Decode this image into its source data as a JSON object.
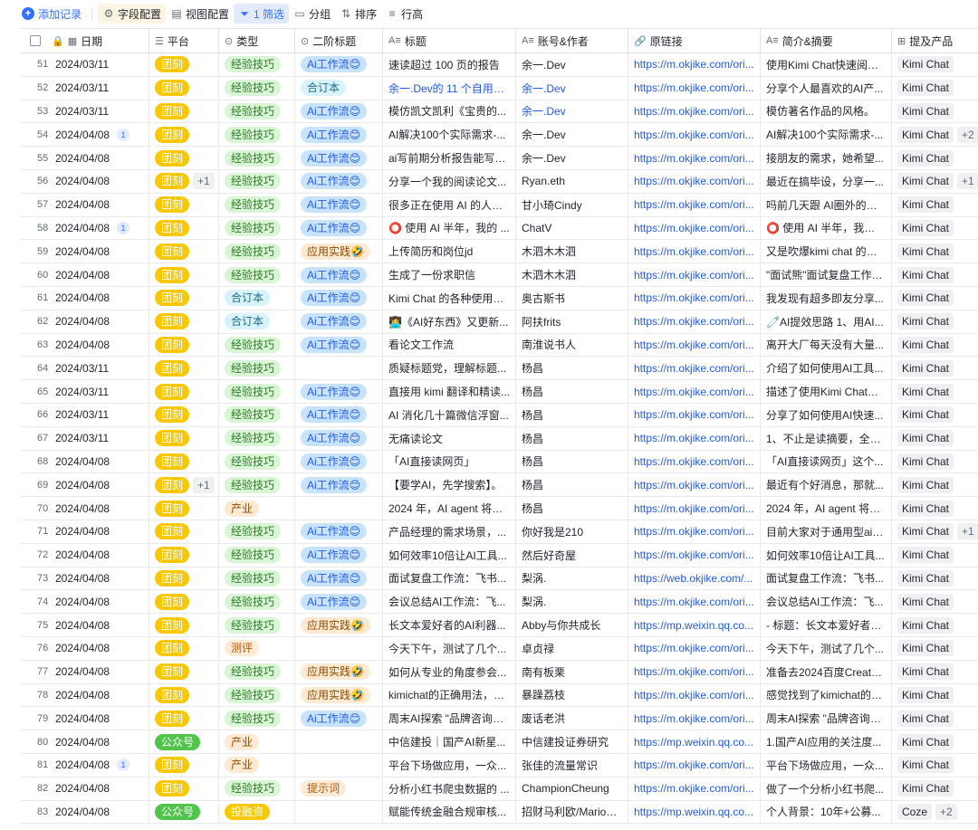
{
  "toolbar": {
    "add": "添加记录",
    "fields": "字段配置",
    "views": "视图配置",
    "filter": "1 筛选",
    "group": "分组",
    "sort": "排序",
    "rowheight": "行高"
  },
  "columns": {
    "date": "日期",
    "platform": "平台",
    "type": "类型",
    "sub": "二阶标题",
    "title": "标题",
    "author": "账号&作者",
    "link": "原链接",
    "summary": "简介&摘要",
    "product": "提及产品"
  },
  "colors": {
    "accent": "#3370ff",
    "tuoke_tag": "#fac800",
    "wechat_tag": "#51c44c"
  },
  "rows": [
    {
      "n": "51",
      "date": "2024/03/11",
      "badge": "",
      "plat": "团刻",
      "platc": "t-yellow",
      "platmore": "",
      "type": "经验技巧",
      "typec": "t-lgreen",
      "sub": "Ai工作流😊",
      "subc": "t-blue",
      "title": "速读超过 100 页的报告",
      "author": "余一.Dev",
      "authorBlue": false,
      "link": "https://m.okjike.com/ori...",
      "sum": "使用Kimi Chat快速阅读...",
      "prod": "Kimi Chat",
      "prodmore": ""
    },
    {
      "n": "52",
      "date": "2024/03/11",
      "badge": "",
      "plat": "团刻",
      "platc": "t-yellow",
      "platmore": "",
      "type": "经验技巧",
      "typec": "t-lgreen",
      "sub": "合订本",
      "subc": "t-lblue",
      "title": "余一.Dev的 11 个自用最...",
      "titleBlue": true,
      "author": "余一.Dev",
      "authorBlue": true,
      "link": "https://m.okjike.com/ori...",
      "sum": "分享个人最喜欢的AI产...",
      "prod": "Kimi Chat",
      "prodmore": ""
    },
    {
      "n": "53",
      "date": "2024/03/11",
      "badge": "",
      "plat": "团刻",
      "platc": "t-yellow",
      "platmore": "",
      "type": "经验技巧",
      "typec": "t-lgreen",
      "sub": "Ai工作流😊",
      "subc": "t-blue",
      "title": "模仿凯文凯利《宝贵的...",
      "author": "余一.Dev",
      "authorBlue": true,
      "link": "https://m.okjike.com/ori...",
      "sum": "模仿著名作品的风格。",
      "prod": "Kimi Chat",
      "prodmore": ""
    },
    {
      "n": "54",
      "date": "2024/04/08",
      "badge": "1",
      "plat": "团刻",
      "platc": "t-yellow",
      "platmore": "",
      "type": "经验技巧",
      "typec": "t-lgreen",
      "sub": "Ai工作流😊",
      "subc": "t-blue",
      "title": "AI解决100个实际需求-...",
      "author": "余一.Dev",
      "authorBlue": false,
      "link": "https://m.okjike.com/ori...",
      "sum": "AI解决100个实际需求-...",
      "prod": "Kimi Chat",
      "prodmore": "+2"
    },
    {
      "n": "55",
      "date": "2024/04/08",
      "badge": "",
      "plat": "团刻",
      "platc": "t-yellow",
      "platmore": "",
      "type": "经验技巧",
      "typec": "t-lgreen",
      "sub": "Ai工作流😊",
      "subc": "t-blue",
      "title": "ai写前期分析报告能写成...",
      "author": "余一.Dev",
      "authorBlue": false,
      "link": "https://m.okjike.com/ori...",
      "sum": "接朋友的需求，她希望...",
      "prod": "Kimi Chat",
      "prodmore": ""
    },
    {
      "n": "56",
      "date": "2024/04/08",
      "badge": "",
      "plat": "团刻",
      "platc": "t-yellow",
      "platmore": "+1",
      "type": "经验技巧",
      "typec": "t-lgreen",
      "sub": "Ai工作流😊",
      "subc": "t-blue",
      "title": "分享一个我的阅读论文...",
      "author": "Ryan.eth",
      "authorBlue": false,
      "link": "https://m.okjike.com/ori...",
      "sum": "最近在搞毕设，分享一...",
      "prod": "Kimi Chat",
      "prodmore": "+1"
    },
    {
      "n": "57",
      "date": "2024/04/08",
      "badge": "",
      "plat": "团刻",
      "platc": "t-yellow",
      "platmore": "",
      "type": "经验技巧",
      "typec": "t-lgreen",
      "sub": "Ai工作流😊",
      "subc": "t-blue",
      "title": "很多正在使用 AI 的人的...",
      "author": "甘小琦Cindy",
      "authorBlue": false,
      "link": "https://m.okjike.com/ori...",
      "sum": "吗前几天跟 AI圈外的两...",
      "prod": "Kimi Chat",
      "prodmore": ""
    },
    {
      "n": "58",
      "date": "2024/04/08",
      "badge": "1",
      "plat": "团刻",
      "platc": "t-yellow",
      "platmore": "",
      "type": "经验技巧",
      "typec": "t-lgreen",
      "sub": "Ai工作流😊",
      "subc": "t-blue",
      "title": "⭕ 使用 AI 半年，我的 ...",
      "author": "ChatV",
      "authorBlue": false,
      "link": "https://m.okjike.com/ori...",
      "sum": "⭕ 使用 AI 半年，我的 ...",
      "prod": "Kimi Chat",
      "prodmore": ""
    },
    {
      "n": "59",
      "date": "2024/04/08",
      "badge": "",
      "plat": "团刻",
      "platc": "t-yellow",
      "platmore": "",
      "type": "经验技巧",
      "typec": "t-lgreen",
      "sub": "应用实践🤣",
      "subc": "t-peach",
      "title": "上传简历和岗位jd",
      "author": "木泗木木泗",
      "authorBlue": false,
      "link": "https://m.okjike.com/ori...",
      "sum": "又是吹爆kimi chat 的一...",
      "prod": "Kimi Chat",
      "prodmore": ""
    },
    {
      "n": "60",
      "date": "2024/04/08",
      "badge": "",
      "plat": "团刻",
      "platc": "t-yellow",
      "platmore": "",
      "type": "经验技巧",
      "typec": "t-lgreen",
      "sub": "Ai工作流😊",
      "subc": "t-blue",
      "title": "生成了一份求职信",
      "author": "木泗木木泗",
      "authorBlue": false,
      "link": "https://m.okjike.com/ori...",
      "sum": "\"面试熊\"面试复盘工作流...",
      "prod": "Kimi Chat",
      "prodmore": ""
    },
    {
      "n": "61",
      "date": "2024/04/08",
      "badge": "",
      "plat": "团刻",
      "platc": "t-yellow",
      "platmore": "",
      "type": "合订本",
      "typec": "t-lblue",
      "sub": "Ai工作流😊",
      "subc": "t-blue",
      "title": "Kimi Chat 的各种使用方...",
      "author": "奥古斯书",
      "authorBlue": false,
      "link": "https://m.okjike.com/ori...",
      "sum": "我发现有超多即友分享...",
      "prod": "Kimi Chat",
      "prodmore": ""
    },
    {
      "n": "62",
      "date": "2024/04/08",
      "badge": "",
      "plat": "团刻",
      "platc": "t-yellow",
      "platmore": "",
      "type": "合订本",
      "typec": "t-lblue",
      "sub": "Ai工作流😊",
      "subc": "t-blue",
      "title": "👩‍💻《AI好东西》又更新...",
      "author": "阿扶frits",
      "authorBlue": false,
      "link": "https://m.okjike.com/ori...",
      "sum": "🧷AI提效思路 1、用AI...",
      "prod": "Kimi Chat",
      "prodmore": ""
    },
    {
      "n": "63",
      "date": "2024/04/08",
      "badge": "",
      "plat": "团刻",
      "platc": "t-yellow",
      "platmore": "",
      "type": "经验技巧",
      "typec": "t-lgreen",
      "sub": "Ai工作流😊",
      "subc": "t-blue",
      "title": "看论文工作流",
      "author": "南淮说书人",
      "authorBlue": false,
      "link": "https://m.okjike.com/ori...",
      "sum": "离开大厂每天没有大量...",
      "prod": "Kimi Chat",
      "prodmore": ""
    },
    {
      "n": "64",
      "date": "2024/03/11",
      "badge": "",
      "plat": "团刻",
      "platc": "t-yellow",
      "platmore": "",
      "type": "经验技巧",
      "typec": "t-lgreen",
      "sub": "",
      "subc": "",
      "title": "质疑标题党，理解标题...",
      "author": "杨昌",
      "authorBlue": false,
      "link": "https://m.okjike.com/ori...",
      "sum": "介绍了如何使用AI工具...",
      "prod": "Kimi Chat",
      "prodmore": ""
    },
    {
      "n": "65",
      "date": "2024/03/11",
      "badge": "",
      "plat": "团刻",
      "platc": "t-yellow",
      "platmore": "",
      "type": "经验技巧",
      "typec": "t-lgreen",
      "sub": "Ai工作流😊",
      "subc": "t-blue",
      "title": "直接用 kimi 翻译和精读...",
      "author": "杨昌",
      "authorBlue": false,
      "link": "https://m.okjike.com/ori...",
      "sum": "描述了使用Kimi Chat翻...",
      "prod": "Kimi Chat",
      "prodmore": ""
    },
    {
      "n": "66",
      "date": "2024/03/11",
      "badge": "",
      "plat": "团刻",
      "platc": "t-yellow",
      "platmore": "",
      "type": "经验技巧",
      "typec": "t-lgreen",
      "sub": "Ai工作流😊",
      "subc": "t-blue",
      "title": "AI 消化几十篇微信浮窗...",
      "author": "杨昌",
      "authorBlue": false,
      "link": "https://m.okjike.com/ori...",
      "sum": "分享了如何使用AI快速...",
      "prod": "Kimi Chat",
      "prodmore": ""
    },
    {
      "n": "67",
      "date": "2024/03/11",
      "badge": "",
      "plat": "团刻",
      "platc": "t-yellow",
      "platmore": "",
      "type": "经验技巧",
      "typec": "t-lgreen",
      "sub": "Ai工作流😊",
      "subc": "t-blue",
      "title": "无痛读论文",
      "author": "杨昌",
      "authorBlue": false,
      "link": "https://m.okjike.com/ori...",
      "sum": "1、不止是读摘要，全文...",
      "prod": "Kimi Chat",
      "prodmore": ""
    },
    {
      "n": "68",
      "date": "2024/04/08",
      "badge": "",
      "plat": "团刻",
      "platc": "t-yellow",
      "platmore": "",
      "type": "经验技巧",
      "typec": "t-lgreen",
      "sub": "Ai工作流😊",
      "subc": "t-blue",
      "title": "「AI直接读网页」",
      "author": "杨昌",
      "authorBlue": false,
      "link": "https://m.okjike.com/ori...",
      "sum": "「AI直接读网页」这个...",
      "prod": "Kimi Chat",
      "prodmore": ""
    },
    {
      "n": "69",
      "date": "2024/04/08",
      "badge": "",
      "plat": "团刻",
      "platc": "t-yellow",
      "platmore": "+1",
      "type": "经验技巧",
      "typec": "t-lgreen",
      "sub": "Ai工作流😊",
      "subc": "t-blue",
      "title": "【要学AI，先学搜索】。",
      "author": "杨昌",
      "authorBlue": false,
      "link": "https://m.okjike.com/ori...",
      "sum": "最近有个好消息，那就...",
      "prod": "Kimi Chat",
      "prodmore": ""
    },
    {
      "n": "70",
      "date": "2024/04/08",
      "badge": "",
      "plat": "团刻",
      "platc": "t-yellow",
      "platmore": "",
      "type": "产业",
      "typec": "t-peach",
      "sub": "",
      "subc": "",
      "title": "2024 年，AI agent 将如...",
      "author": "杨昌",
      "authorBlue": false,
      "link": "https://m.okjike.com/ori...",
      "sum": "2024 年，AI agent 将如...",
      "prod": "Kimi Chat",
      "prodmore": ""
    },
    {
      "n": "71",
      "date": "2024/04/08",
      "badge": "",
      "plat": "团刻",
      "platc": "t-yellow",
      "platmore": "",
      "type": "经验技巧",
      "typec": "t-lgreen",
      "sub": "Ai工作流😊",
      "subc": "t-blue",
      "title": "产品经理的需求场景，...",
      "author": "你好我是210",
      "authorBlue": false,
      "link": "https://m.okjike.com/ori...",
      "sum": "目前大家对于通用型ai工...",
      "prod": "Kimi Chat",
      "prodmore": "+1"
    },
    {
      "n": "72",
      "date": "2024/04/08",
      "badge": "",
      "plat": "团刻",
      "platc": "t-yellow",
      "platmore": "",
      "type": "经验技巧",
      "typec": "t-lgreen",
      "sub": "Ai工作流😊",
      "subc": "t-blue",
      "title": "如何效率10倍让AI工具...",
      "author": "然后好奇屋",
      "authorBlue": false,
      "link": "https://m.okjike.com/ori...",
      "sum": "如何效率10倍让AI工具...",
      "prod": "Kimi Chat",
      "prodmore": ""
    },
    {
      "n": "73",
      "date": "2024/04/08",
      "badge": "",
      "plat": "团刻",
      "platc": "t-yellow",
      "platmore": "",
      "type": "经验技巧",
      "typec": "t-lgreen",
      "sub": "Ai工作流😊",
      "subc": "t-blue",
      "title": "面试复盘工作流：飞书...",
      "author": "梨涡.",
      "authorBlue": false,
      "link": "https://web.okjike.com/...",
      "sum": "面试复盘工作流：飞书...",
      "prod": "Kimi Chat",
      "prodmore": ""
    },
    {
      "n": "74",
      "date": "2024/04/08",
      "badge": "",
      "plat": "团刻",
      "platc": "t-yellow",
      "platmore": "",
      "type": "经验技巧",
      "typec": "t-lgreen",
      "sub": "Ai工作流😊",
      "subc": "t-blue",
      "title": "会议总结AI工作流：飞...",
      "author": "梨涡.",
      "authorBlue": false,
      "link": "https://m.okjike.com/ori...",
      "sum": "会议总结AI工作流：飞...",
      "prod": "Kimi Chat",
      "prodmore": ""
    },
    {
      "n": "75",
      "date": "2024/04/08",
      "badge": "",
      "plat": "团刻",
      "platc": "t-yellow",
      "platmore": "",
      "type": "经验技巧",
      "typec": "t-lgreen",
      "sub": "应用实践🤣",
      "subc": "t-peach",
      "title": "长文本爱好者的AI利器...",
      "author": "Abby与你共成长",
      "authorBlue": false,
      "link": "https://mp.weixin.qq.co...",
      "sum": "- 标题：长文本爱好者的...",
      "prod": "Kimi Chat",
      "prodmore": ""
    },
    {
      "n": "76",
      "date": "2024/04/08",
      "badge": "",
      "plat": "团刻",
      "platc": "t-yellow",
      "platmore": "",
      "type": "测评",
      "typec": "t-orange",
      "sub": "",
      "subc": "",
      "title": "今天下午，测试了几个...",
      "author": "卓贞禄",
      "authorBlue": false,
      "link": "https://m.okjike.com/ori...",
      "sum": "今天下午，测试了几个...",
      "prod": "Kimi Chat",
      "prodmore": ""
    },
    {
      "n": "77",
      "date": "2024/04/08",
      "badge": "",
      "plat": "团刻",
      "platc": "t-yellow",
      "platmore": "",
      "type": "经验技巧",
      "typec": "t-lgreen",
      "sub": "应用实践🤣",
      "subc": "t-peach",
      "title": "如何从专业的角度参会...",
      "author": "南有板栗",
      "authorBlue": false,
      "link": "https://m.okjike.com/ori...",
      "sum": "准备去2024百度Create ...",
      "prod": "Kimi Chat",
      "prodmore": ""
    },
    {
      "n": "78",
      "date": "2024/04/08",
      "badge": "",
      "plat": "团刻",
      "platc": "t-yellow",
      "platmore": "",
      "type": "经验技巧",
      "typec": "t-lgreen",
      "sub": "应用实践🤣",
      "subc": "t-peach",
      "title": "kimichat的正确用法，用...",
      "author": "暴躁荔枝",
      "authorBlue": false,
      "link": "https://m.okjike.com/ori...",
      "sum": "感觉找到了kimichat的正...",
      "prod": "Kimi Chat",
      "prodmore": ""
    },
    {
      "n": "79",
      "date": "2024/04/08",
      "badge": "",
      "plat": "团刻",
      "platc": "t-yellow",
      "platmore": "",
      "type": "经验技巧",
      "typec": "t-lgreen",
      "sub": "Ai工作流😊",
      "subc": "t-blue",
      "title": "周末AI探索 \"品牌咨询服...",
      "author": "废话老洪",
      "authorBlue": false,
      "link": "https://m.okjike.com/ori...",
      "sum": "周末AI探索 \"品牌咨询服...",
      "prod": "Kimi Chat",
      "prodmore": ""
    },
    {
      "n": "80",
      "date": "2024/04/08",
      "badge": "",
      "plat": "公众号",
      "platc": "t-green",
      "platmore": "",
      "type": "产业",
      "typec": "t-peach",
      "sub": "",
      "subc": "",
      "title": "中信建投｜国产AI新星...",
      "author": "中信建投证券研究",
      "authorBlue": false,
      "link": "https://mp.weixin.qq.co...",
      "sum": "1.国产AI应用的关注度...",
      "prod": "Kimi Chat",
      "prodmore": ""
    },
    {
      "n": "81",
      "date": "2024/04/08",
      "badge": "1",
      "plat": "团刻",
      "platc": "t-yellow",
      "platmore": "",
      "type": "产业",
      "typec": "t-peach",
      "sub": "",
      "subc": "",
      "title": "平台下场做应用，一众...",
      "author": "张佳的流量常识",
      "authorBlue": false,
      "link": "https://m.okjike.com/ori...",
      "sum": "平台下场做应用，一众...",
      "prod": "Kimi Chat",
      "prodmore": ""
    },
    {
      "n": "82",
      "date": "2024/04/08",
      "badge": "",
      "plat": "团刻",
      "platc": "t-yellow",
      "platmore": "",
      "type": "经验技巧",
      "typec": "t-lgreen",
      "sub": "提示词",
      "subc": "t-orange",
      "title": "分析小红书爬虫数据的 ...",
      "author": "ChampionCheung",
      "authorBlue": false,
      "link": "https://m.okjike.com/ori...",
      "sum": "做了一个分析小红书爬...",
      "prod": "Kimi Chat",
      "prodmore": ""
    },
    {
      "n": "83",
      "date": "2024/04/08",
      "badge": "",
      "plat": "公众号",
      "platc": "t-green",
      "platmore": "",
      "type": "投融资",
      "typec": "t-yellow",
      "sub": "",
      "subc": "",
      "title": "赋能传统金融合规审核...",
      "author": "招财马利欧/Mario申...",
      "authorBlue": false,
      "link": "https://mp.weixin.qq.co...",
      "sum": "个人背景：10年+公募...",
      "prod": "Coze",
      "prodmore": "+2"
    }
  ]
}
